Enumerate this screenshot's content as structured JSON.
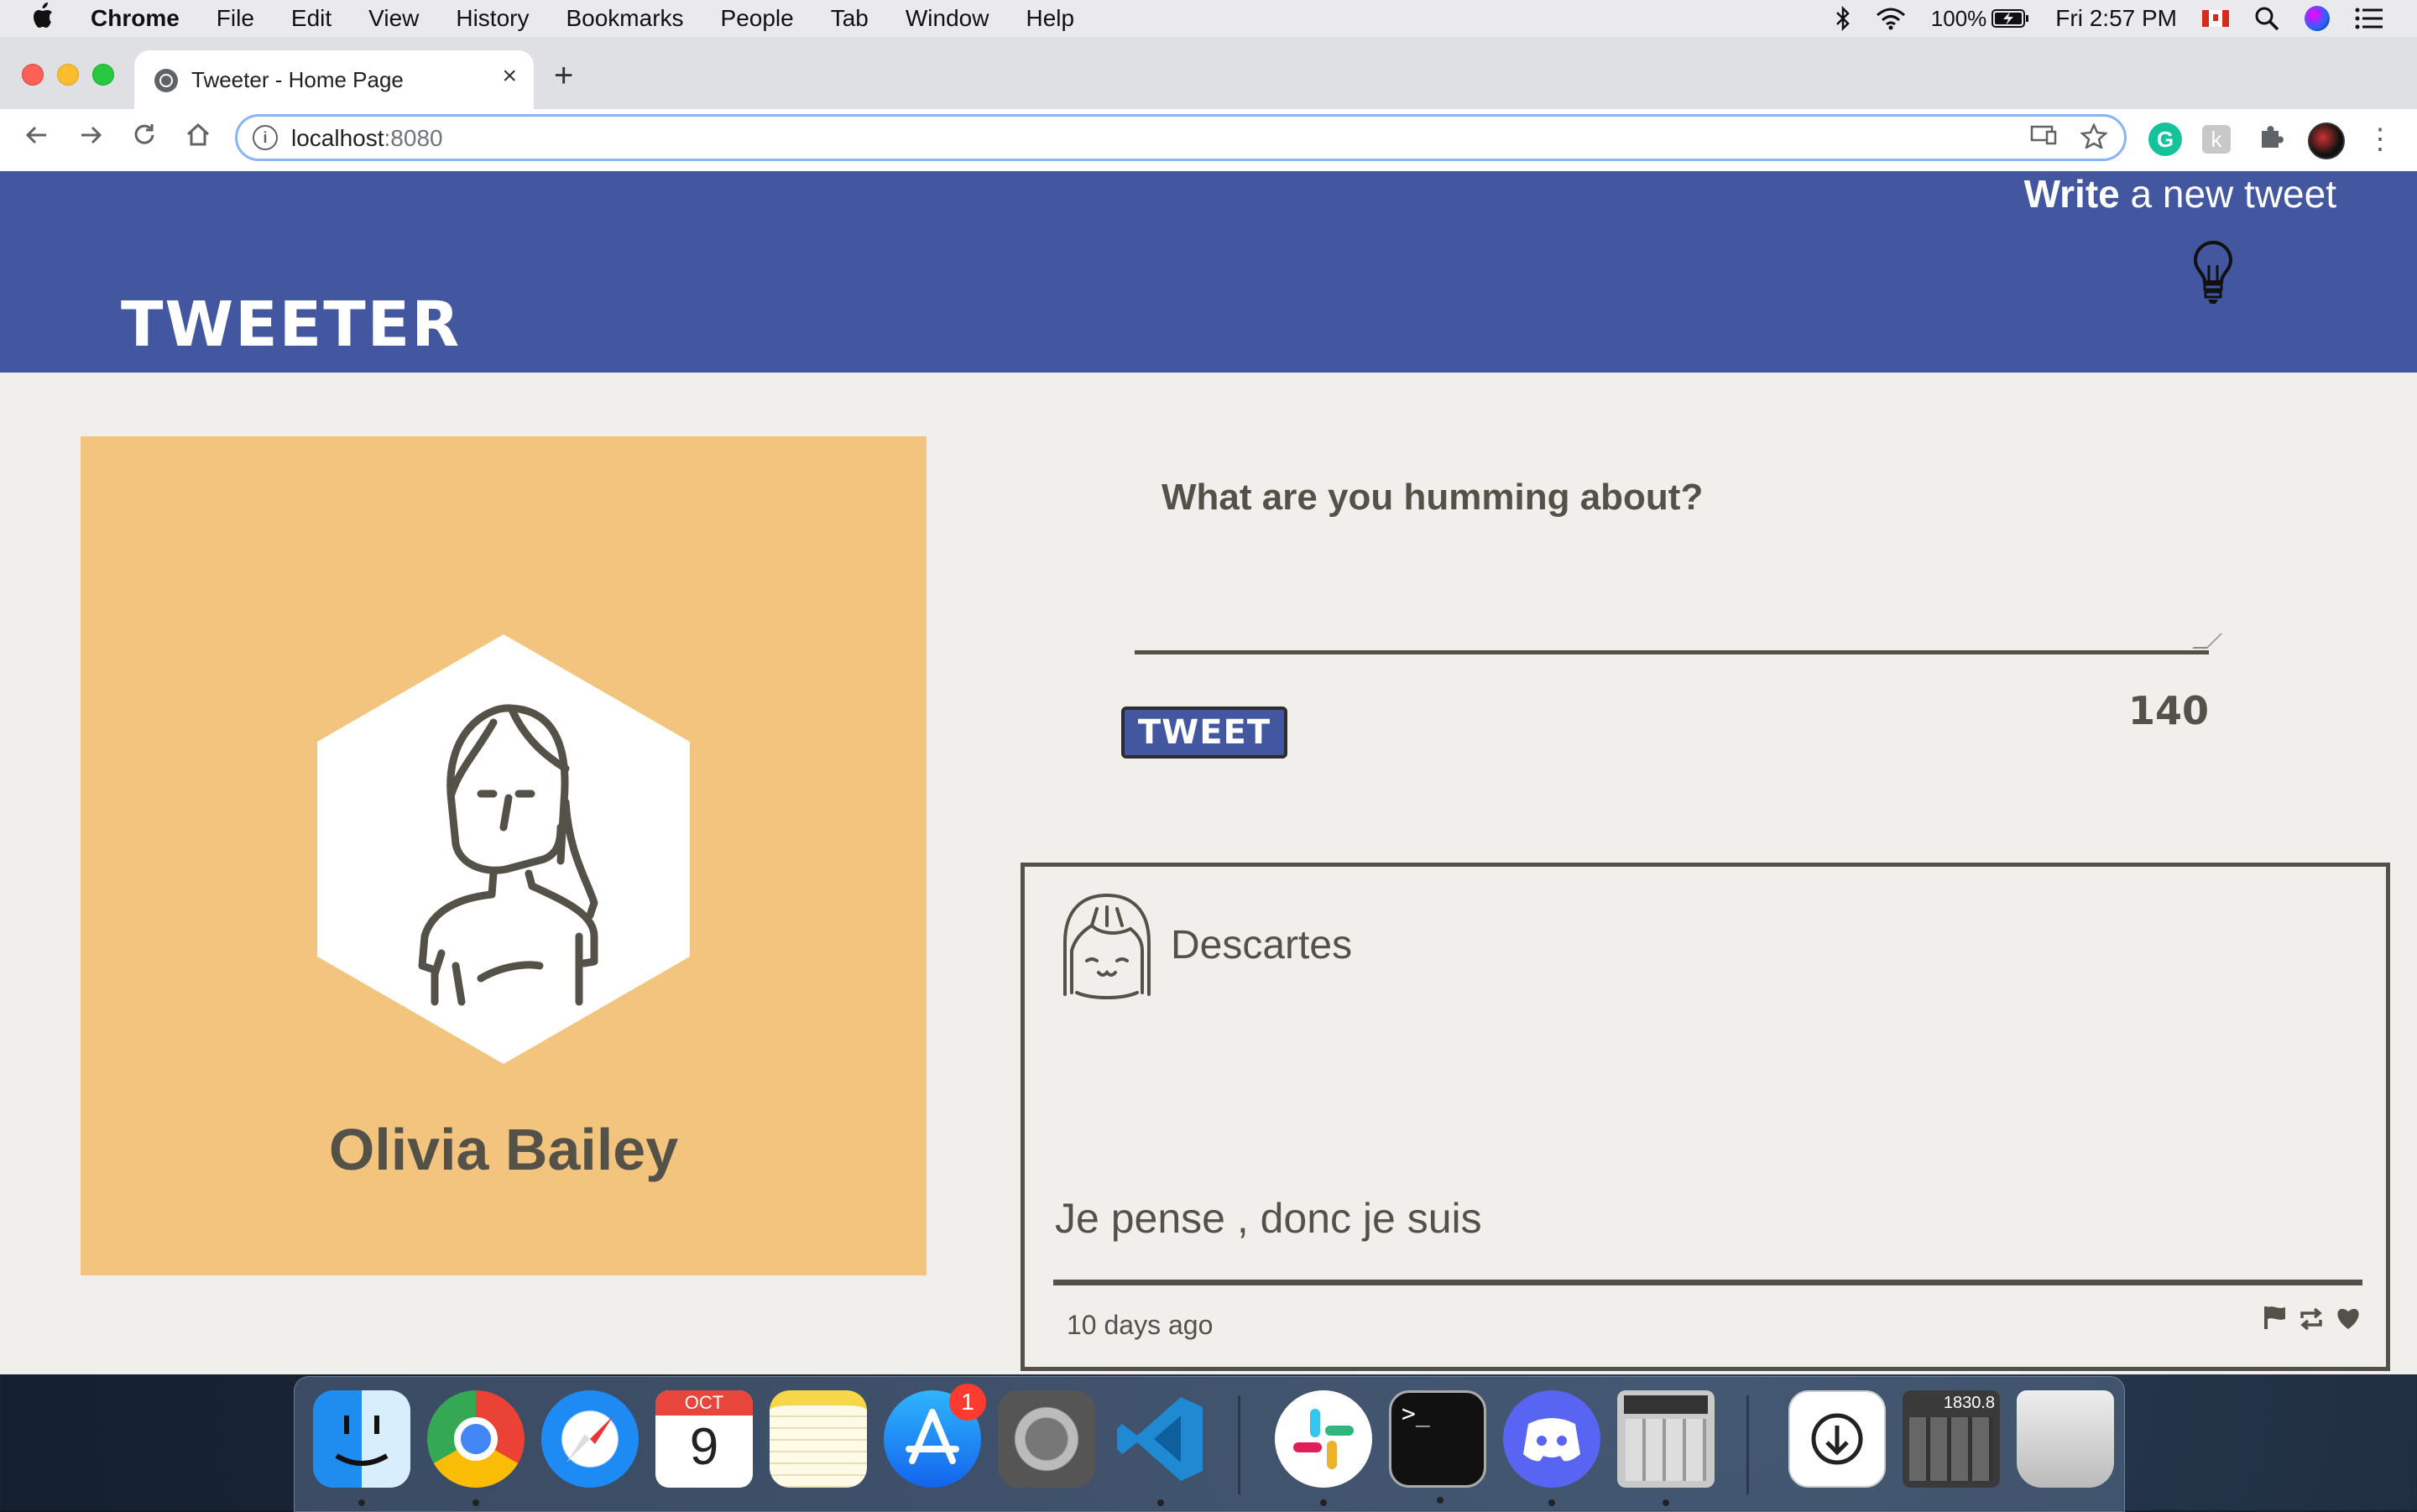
{
  "menubar": {
    "apple": "",
    "app_name": "Chrome",
    "menus": [
      "File",
      "Edit",
      "View",
      "History",
      "Bookmarks",
      "People",
      "Tab",
      "Window",
      "Help"
    ],
    "battery": "100%",
    "clock": "Fri 2:57 PM"
  },
  "browser": {
    "tab_title": "Tweeter - Home Page",
    "tab_close": "×",
    "new_tab": "+",
    "url_host": "localhost",
    "url_port": ":8080"
  },
  "page": {
    "brand": "TWEETER",
    "compose_toggle": {
      "bold": "Write",
      "rest": " a new tweet"
    },
    "profile": {
      "name": "Olivia Bailey"
    },
    "compose": {
      "prompt": "What are you humming about?",
      "textarea_value": "",
      "button": "TWEET",
      "counter": "140"
    },
    "tweets": [
      {
        "author": "Descartes",
        "content": "Je pense , donc je suis",
        "time": "10 days ago"
      }
    ]
  },
  "dock": {
    "calendar_month": "OCT",
    "calendar_day": "9",
    "app_store_badge": "1",
    "calculator_display": "1830.8"
  },
  "colors": {
    "header": "#4257a0",
    "profile_card": "#f3c47d",
    "page_bg": "#f1efeb",
    "text": "#545149"
  }
}
